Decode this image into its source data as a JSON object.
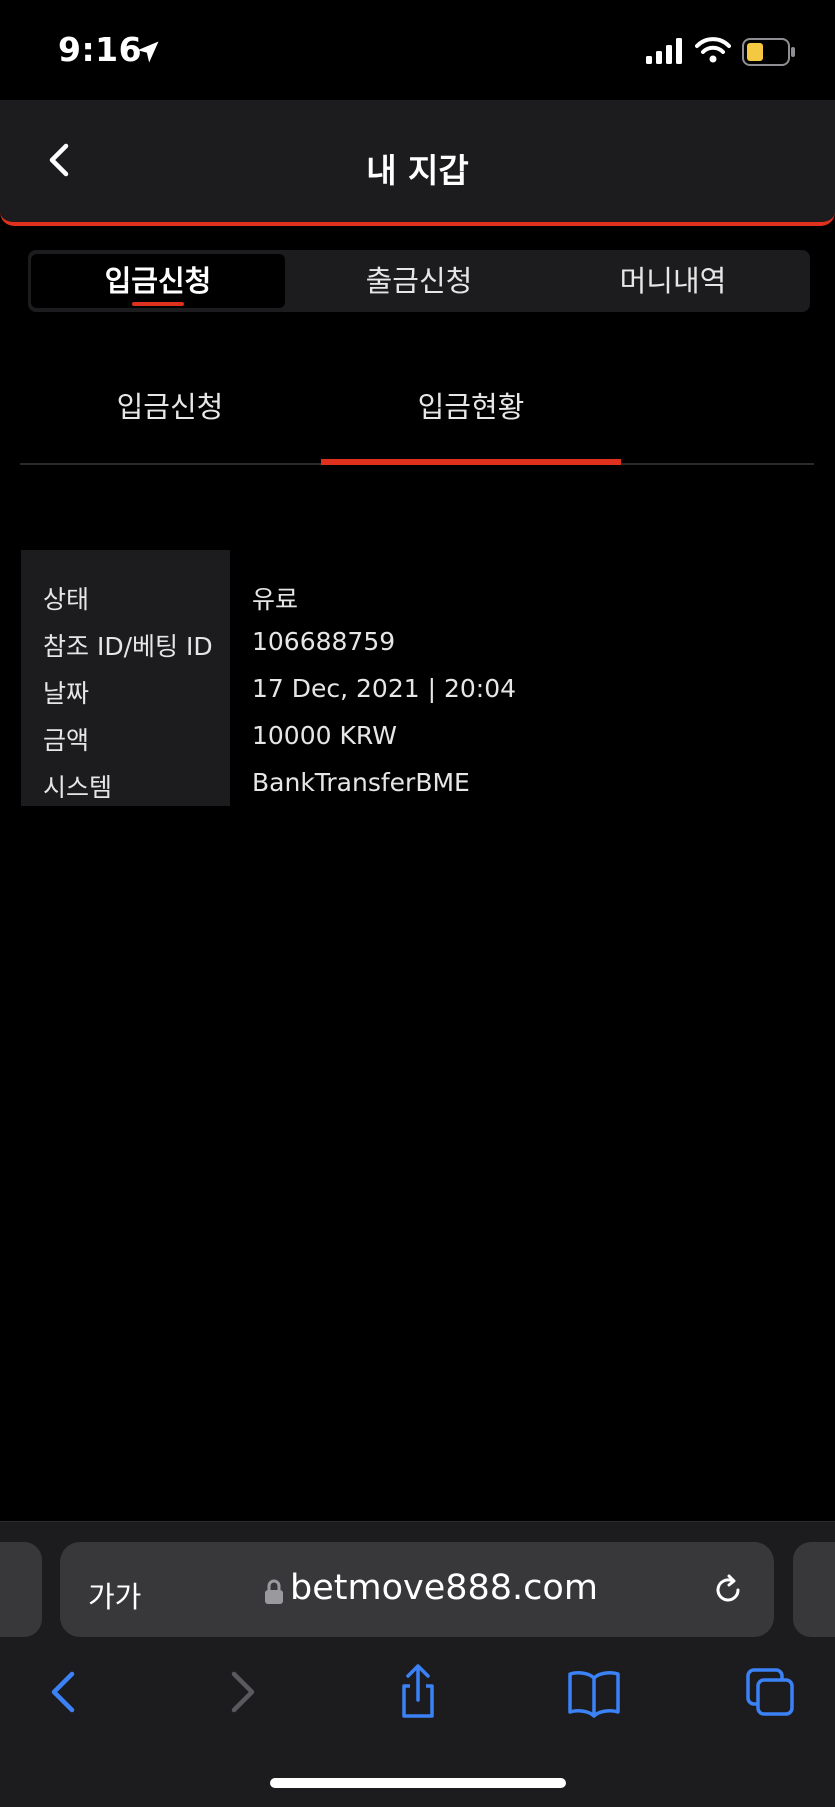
{
  "status_bar": {
    "time": "9:16"
  },
  "header": {
    "title": "내 지갑"
  },
  "tabs": [
    {
      "label": "입금신청",
      "active": true
    },
    {
      "label": "출금신청",
      "active": false
    },
    {
      "label": "머니내역",
      "active": false
    }
  ],
  "subtabs": [
    {
      "label": "입금신청",
      "active": false
    },
    {
      "label": "입금현황",
      "active": true
    }
  ],
  "details": [
    {
      "label": "상태",
      "value": "유료"
    },
    {
      "label": "참조 ID/베팅 ID",
      "value": "106688759"
    },
    {
      "label": "날짜",
      "value": "17 Dec, 2021 | 20:04"
    },
    {
      "label": "금액",
      "value": "10000 KRW"
    },
    {
      "label": "시스템",
      "value": "BankTransferBME"
    }
  ],
  "browser": {
    "aa_label": "가가",
    "url": "betmove888.com"
  },
  "colors": {
    "accent": "#e0301e",
    "panel": "#1c1c1f",
    "background": "#000000",
    "ios_blue": "#3b82f6"
  }
}
